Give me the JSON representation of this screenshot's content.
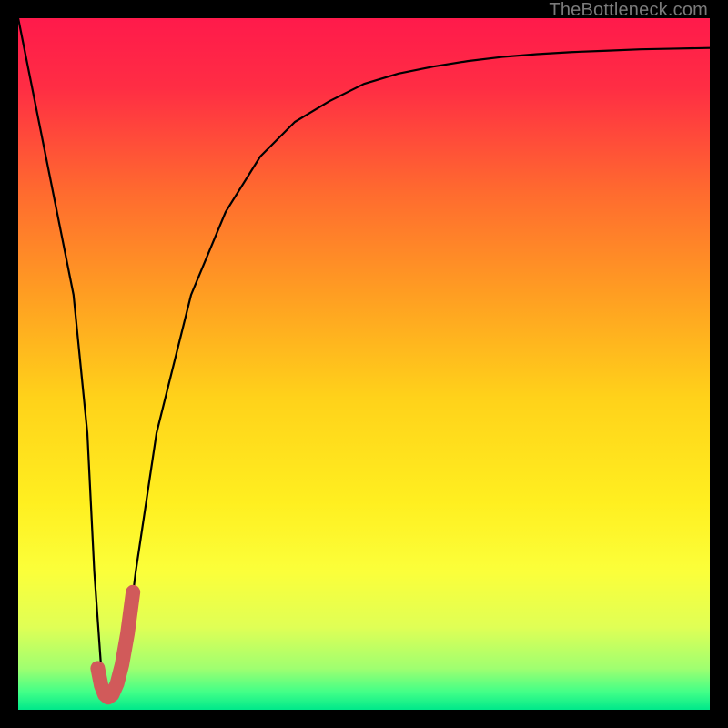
{
  "watermark": "TheBottleneck.com",
  "gradient_stops": [
    {
      "offset": 0.0,
      "color": "#ff1a4b"
    },
    {
      "offset": 0.1,
      "color": "#ff2d44"
    },
    {
      "offset": 0.25,
      "color": "#ff6a2f"
    },
    {
      "offset": 0.4,
      "color": "#ff9e22"
    },
    {
      "offset": 0.55,
      "color": "#ffd21a"
    },
    {
      "offset": 0.7,
      "color": "#ffef20"
    },
    {
      "offset": 0.8,
      "color": "#fbff3a"
    },
    {
      "offset": 0.88,
      "color": "#e0ff55"
    },
    {
      "offset": 0.94,
      "color": "#a0ff70"
    },
    {
      "offset": 0.975,
      "color": "#40ff88"
    },
    {
      "offset": 1.0,
      "color": "#00e88a"
    }
  ],
  "chart_data": {
    "type": "line",
    "title": "",
    "xlabel": "",
    "ylabel": "",
    "xlim": [
      0,
      100
    ],
    "ylim": [
      0,
      100
    ],
    "note": "x is normalized horizontal position (0=left,100=right); y is normalized vertical value (0=bottom green, 100=top red). Background color encodes bottleneck severity from green (good) to red (bad).",
    "series": [
      {
        "name": "bottleneck-curve",
        "x": [
          0,
          2,
          4,
          6,
          8,
          10,
          11,
          12,
          13,
          14,
          15,
          17,
          20,
          25,
          30,
          35,
          40,
          45,
          50,
          55,
          60,
          65,
          70,
          75,
          80,
          85,
          90,
          95,
          100
        ],
        "y": [
          100,
          90,
          80,
          70,
          60,
          40,
          20,
          6,
          2,
          2,
          4,
          20,
          40,
          60,
          72,
          80,
          85,
          88,
          90.5,
          92,
          93,
          93.8,
          94.4,
          94.8,
          95.1,
          95.3,
          95.5,
          95.6,
          95.7
        ]
      },
      {
        "name": "highlight-segment",
        "color": "#d15a5a",
        "x": [
          11.5,
          12.0,
          12.5,
          13.0,
          13.6,
          14.3,
          15.0,
          15.8,
          16.6
        ],
        "y": [
          6.0,
          3.5,
          2.2,
          1.8,
          2.2,
          3.8,
          6.5,
          11.0,
          17.0
        ]
      }
    ]
  }
}
